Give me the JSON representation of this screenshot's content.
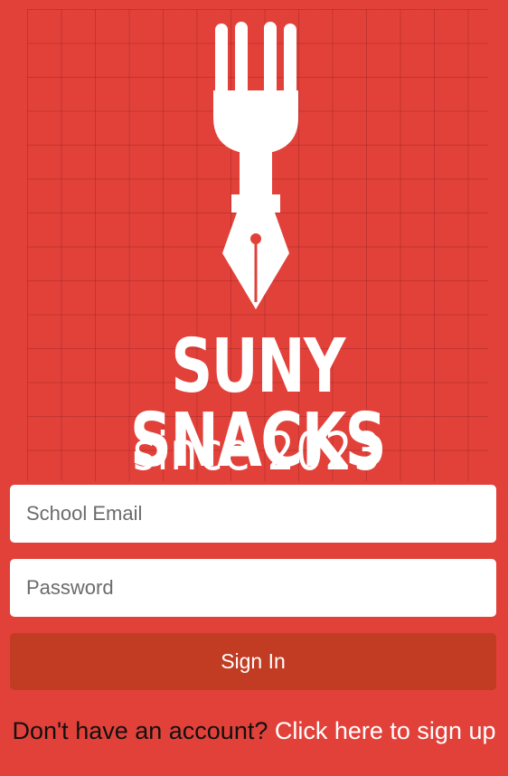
{
  "brand": {
    "title": "SUNY SNACKS",
    "subtitle": "since 2023",
    "logo_icon": "fork-pen-nib-icon"
  },
  "login": {
    "email_placeholder": "School Email",
    "password_placeholder": "Password",
    "signin_label": "Sign In"
  },
  "signup": {
    "prompt": "Don't have an account?",
    "link": "Click here to sign up"
  },
  "colors": {
    "background": "#e2413a",
    "button": "#c13c22",
    "grid": "#8a1f1f"
  }
}
